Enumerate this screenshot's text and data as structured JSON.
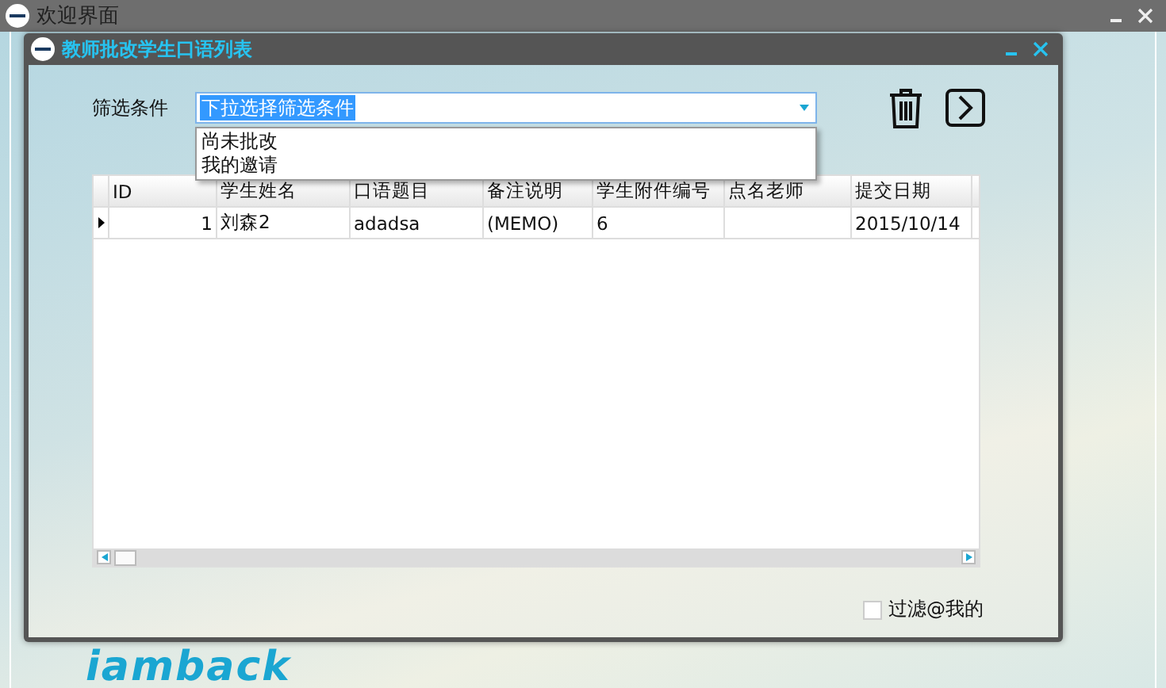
{
  "main_window": {
    "title": "欢迎界面",
    "logo_text": "iamback"
  },
  "dialog": {
    "title": "教师批改学生口语列表"
  },
  "filter": {
    "label": "筛选条件",
    "value": "下拉选择筛选条件",
    "expanded": true,
    "options": [
      "尚未批改",
      "我的邀请"
    ]
  },
  "grid": {
    "columns": [
      "ID",
      "学生姓名",
      "口语题目",
      "备注说明",
      "学生附件编号",
      "点名老师",
      "提交日期"
    ],
    "rows": [
      {
        "selected": true,
        "cells": [
          "1",
          "刘森2",
          "adadsa",
          "(MEMO)",
          "6",
          "",
          "2015/10/14"
        ]
      }
    ]
  },
  "filter_mine": {
    "label": "过滤@我的",
    "checked": false
  }
}
